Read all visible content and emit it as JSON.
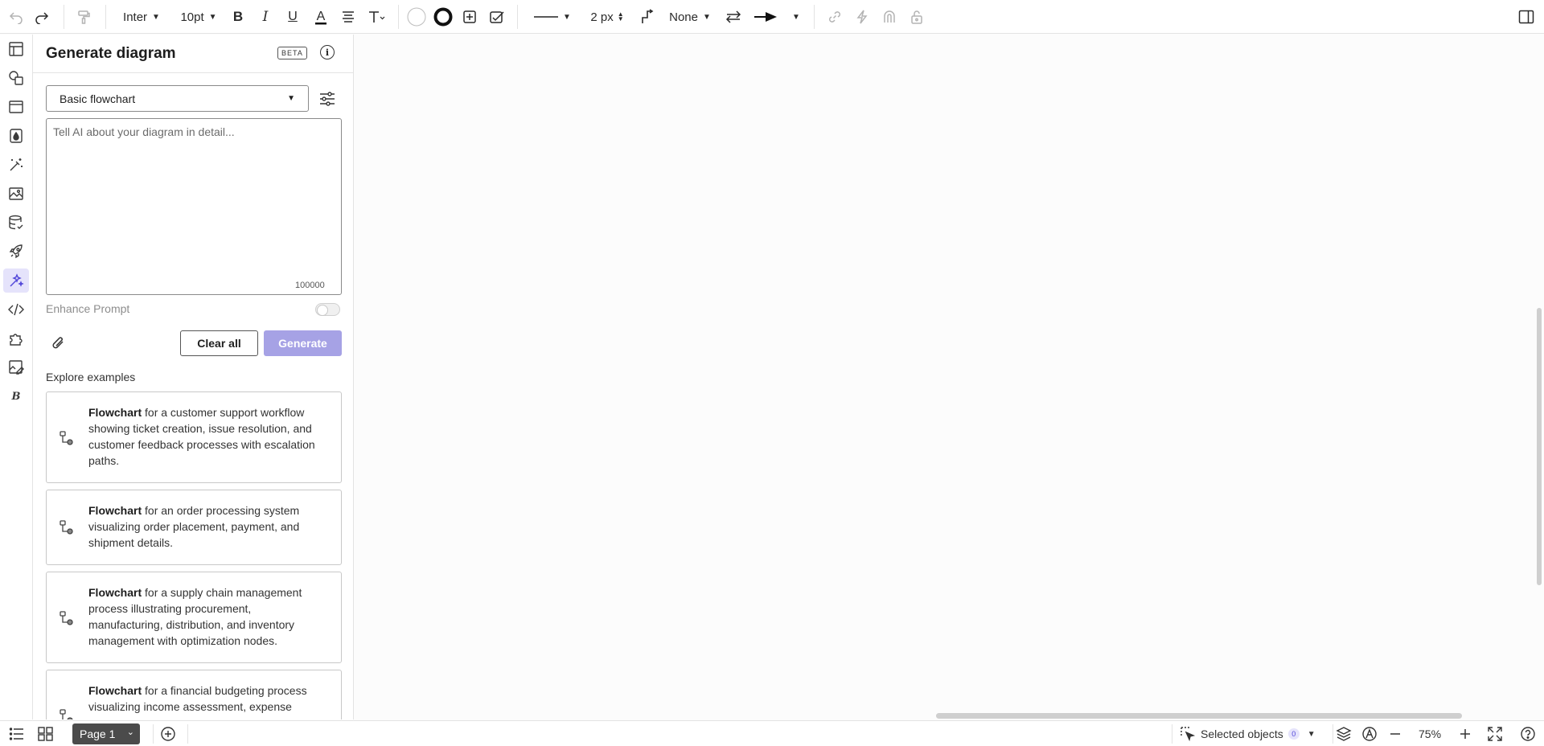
{
  "toolbar": {
    "font_family": "Inter",
    "font_size": "10pt",
    "line_width": "2 px",
    "line_end": "None"
  },
  "panel": {
    "title": "Generate diagram",
    "beta": "BETA",
    "info": "i",
    "diagram_type": "Basic flowchart",
    "prompt_placeholder": "Tell AI about your diagram in detail...",
    "char_limit": "100000",
    "enhance_label": "Enhance Prompt",
    "enhance_enabled": false,
    "clear_label": "Clear all",
    "generate_label": "Generate",
    "explore_label": "Explore examples",
    "examples": [
      {
        "bold": "Flowchart",
        "text": " for a customer support workflow showing ticket creation, issue resolution, and customer feedback processes with escalation paths."
      },
      {
        "bold": "Flowchart",
        "text": " for an order processing system visualizing order placement, payment, and shipment details."
      },
      {
        "bold": "Flowchart",
        "text": " for a supply chain management process illustrating procurement, manufacturing, distribution, and inventory management with optimization nodes."
      },
      {
        "bold": "Flowchart",
        "text": " for a financial budgeting process visualizing income assessment, expense"
      }
    ]
  },
  "bottom": {
    "page_label": "Page 1",
    "selected_label": "Selected objects",
    "selected_count": "0",
    "zoom": "75%"
  },
  "icons": {
    "toolbar": [
      "undo-icon",
      "redo-icon",
      "format-painter-icon",
      "bold-icon",
      "italic-icon",
      "underline-icon",
      "text-color-icon",
      "align-icon",
      "text-options-icon",
      "fill-color-icon",
      "border-color-icon",
      "shape-options-icon",
      "style-icon",
      "line-style-icon",
      "waypoint-icon",
      "swap-arrows-icon",
      "arrow-end-icon",
      "link-icon",
      "lightning-icon",
      "magnet-icon",
      "lock-icon",
      "panel-toggle-icon"
    ],
    "rail": [
      "layout-icon",
      "shapes-icon",
      "container-icon",
      "fill-icon",
      "magic-wand-icon",
      "image-icon",
      "database-icon",
      "rocket-icon",
      "ai-sparkle-icon",
      "code-icon",
      "plugin-icon",
      "image-edit-icon",
      "b-logo-icon"
    ]
  },
  "colors": {
    "accent": "#5146d9",
    "accent_soft": "#e5e3fb",
    "generate_disabled": "#a6a2e5",
    "page_tab": "#4b4b4b"
  }
}
